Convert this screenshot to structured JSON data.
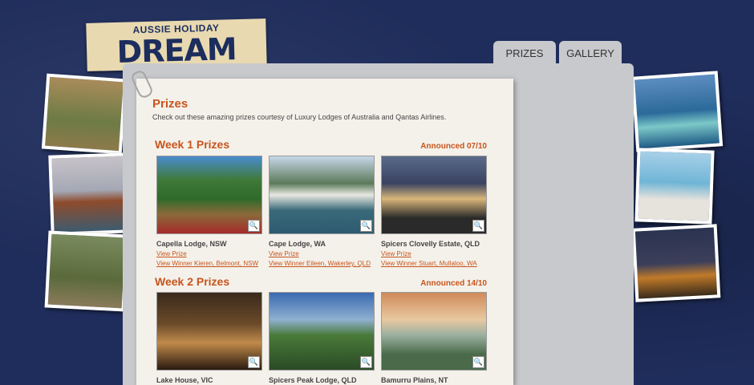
{
  "logo": {
    "top": "AUSSIE HOLIDAY",
    "main": "DREAM TEAM"
  },
  "tabs": [
    "PRIZES",
    "GALLERY"
  ],
  "page": {
    "heading": "Prizes",
    "intro": "Check out these amazing prizes courtesy of Luxury Lodges of Australia and Qantas Airlines."
  },
  "weeks": [
    {
      "title": "Week 1 Prizes",
      "announced": "Announced 07/10",
      "cards": [
        {
          "name": "Capella Lodge, NSW",
          "link1": "View Prize",
          "link2": "View Winner Kieren, Belmont, NSW"
        },
        {
          "name": "Cape Lodge, WA",
          "link1": "View Prize",
          "link2": "View Winner Eileen, Wakerley, QLD"
        },
        {
          "name": "Spicers Clovelly Estate, QLD",
          "link1": "View Prize",
          "link2": "View Winner Stuart, Mullaloo, WA"
        }
      ]
    },
    {
      "title": "Week 2 Prizes",
      "announced": "Announced 14/10",
      "cards": [
        {
          "name": "Lake House, VIC"
        },
        {
          "name": "Spicers Peak Lodge, QLD"
        },
        {
          "name": "Bamurru Plains, NT"
        }
      ]
    }
  ],
  "colors": {
    "accent": "#c8541c",
    "background": "#1f2d5c",
    "panel": "#c8c9cc",
    "paper": "#f4f1ea"
  }
}
